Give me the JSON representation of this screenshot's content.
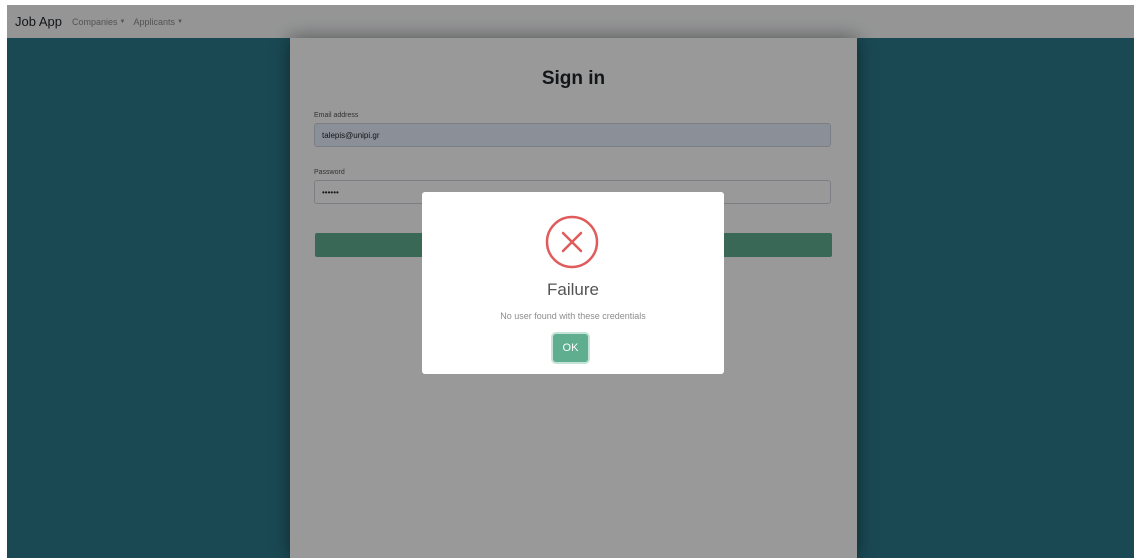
{
  "navbar": {
    "brand": "Job App",
    "items": [
      {
        "label": "Companies"
      },
      {
        "label": "Applicants"
      }
    ]
  },
  "form": {
    "title": "Sign in",
    "email_label": "Email address",
    "email_value": "talepis@unipi.gr",
    "password_label": "Password",
    "password_value": "••••••"
  },
  "dialog": {
    "icon": "error-x-icon",
    "title": "Failure",
    "message": "No user found with these credentials",
    "ok_label": "OK"
  },
  "colors": {
    "page_background": "#2c7a8c",
    "accent": "#5fae8f",
    "error": "#e05b5b"
  }
}
